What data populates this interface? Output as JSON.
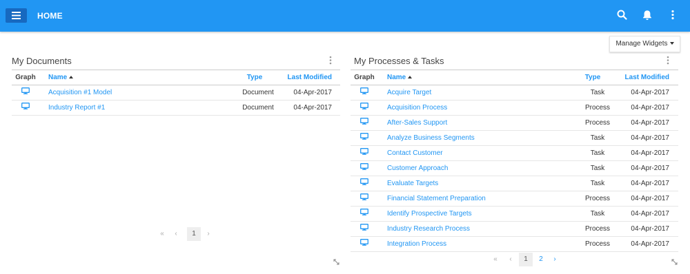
{
  "header": {
    "title": "HOME"
  },
  "icons": {
    "menu": "hamburger-menu-icon",
    "search": "search-icon",
    "bell": "bell-icon",
    "more": "more-vertical-icon",
    "graph": "monitor-icon",
    "resize": "resize-icon"
  },
  "colors": {
    "accent": "#2196f3",
    "menu_button": "#1769c0"
  },
  "toolbar": {
    "manage_widgets_label": "Manage Widgets"
  },
  "documents": {
    "title": "My Documents",
    "columns": {
      "graph": "Graph",
      "name": "Name",
      "type": "Type",
      "modified": "Last Modified"
    },
    "rows": [
      {
        "name": "Acquisition #1 Model",
        "type": "Document",
        "modified": "04-Apr-2017"
      },
      {
        "name": "Industry Report #1",
        "type": "Document",
        "modified": "04-Apr-2017"
      }
    ],
    "pager": {
      "first": "«",
      "prev": "‹",
      "current": "1",
      "next": "›"
    }
  },
  "processes": {
    "title": "My Processes & Tasks",
    "columns": {
      "graph": "Graph",
      "name": "Name",
      "type": "Type",
      "modified": "Last Modified"
    },
    "rows": [
      {
        "name": "Acquire Target",
        "type": "Task",
        "modified": "04-Apr-2017"
      },
      {
        "name": "Acquisition Process",
        "type": "Process",
        "modified": "04-Apr-2017"
      },
      {
        "name": "After-Sales Support",
        "type": "Process",
        "modified": "04-Apr-2017"
      },
      {
        "name": "Analyze Business Segments",
        "type": "Task",
        "modified": "04-Apr-2017"
      },
      {
        "name": "Contact Customer",
        "type": "Task",
        "modified": "04-Apr-2017"
      },
      {
        "name": "Customer Approach",
        "type": "Task",
        "modified": "04-Apr-2017"
      },
      {
        "name": "Evaluate Targets",
        "type": "Task",
        "modified": "04-Apr-2017"
      },
      {
        "name": "Financial Statement Preparation",
        "type": "Process",
        "modified": "04-Apr-2017"
      },
      {
        "name": "Identify Prospective Targets",
        "type": "Task",
        "modified": "04-Apr-2017"
      },
      {
        "name": "Industry Research Process",
        "type": "Process",
        "modified": "04-Apr-2017"
      },
      {
        "name": "Integration Process",
        "type": "Process",
        "modified": "04-Apr-2017"
      }
    ],
    "pager": {
      "first": "«",
      "prev": "‹",
      "current": "1",
      "page2": "2",
      "next": "›"
    }
  }
}
